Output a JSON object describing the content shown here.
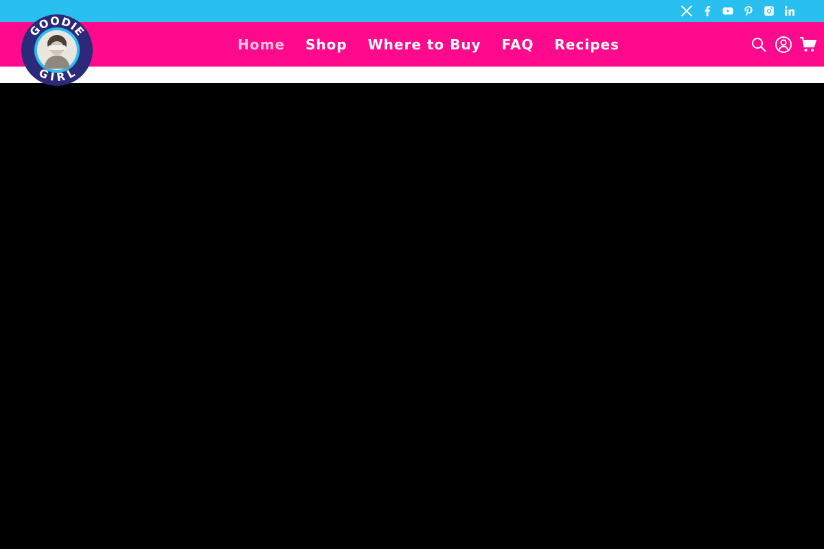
{
  "brand": {
    "logo_top_text": "GOODIE",
    "logo_bottom_text": "GIRL",
    "colors": {
      "topbar": "#29c0f0",
      "navbar": "#ff0a8c",
      "logo_ring": "#2b2a7a",
      "logo_inner": "#29c0f0"
    }
  },
  "social": [
    {
      "name": "x-icon"
    },
    {
      "name": "facebook-icon"
    },
    {
      "name": "youtube-icon"
    },
    {
      "name": "pinterest-icon"
    },
    {
      "name": "instagram-icon"
    },
    {
      "name": "linkedin-icon"
    }
  ],
  "nav": {
    "items": [
      {
        "label": "Home",
        "active": true
      },
      {
        "label": "Shop"
      },
      {
        "label": "Where to Buy"
      },
      {
        "label": "FAQ"
      },
      {
        "label": "Recipes"
      }
    ]
  },
  "tools": [
    {
      "name": "search-icon"
    },
    {
      "name": "account-icon"
    },
    {
      "name": "cart-icon"
    }
  ]
}
